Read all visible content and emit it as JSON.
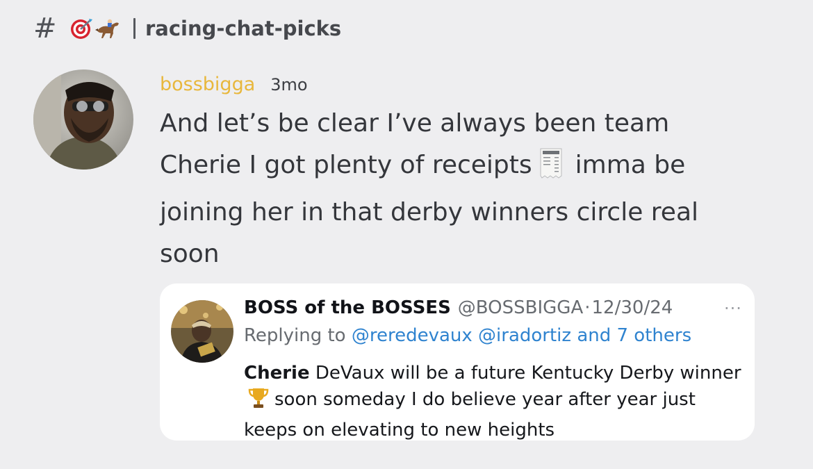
{
  "channel": {
    "hash": "#",
    "emoji": [
      "target-emoji",
      "horse-racing-emoji"
    ],
    "name": "racing-chat-picks"
  },
  "message": {
    "username": "bossbigga",
    "username_color": "#e8b73c",
    "time": "3mo",
    "text_before_emoji": "And let’s be clear I’ve always been team Cherie I got plenty of receipts",
    "emoji": "receipt-emoji",
    "text_after_emoji": "imma be joining her in that derby winners circle real soon"
  },
  "embed": {
    "display_name": "BOSS of the BOSSES",
    "handle": "@BOSSBIGGA",
    "separator": "·",
    "date": "12/30/24",
    "more": "···",
    "replying_prefix": "Replying to",
    "replying_link": "@reredevaux @iradortiz and 7 others",
    "link_color": "#2f83cf",
    "text_bold": "Cherie",
    "text_part1": "DeVaux will be a future Kentucky Derby winner",
    "emoji": "trophy-emoji",
    "text_part2": "soon someday I do believe year after year just keeps on elevating to new heights"
  }
}
